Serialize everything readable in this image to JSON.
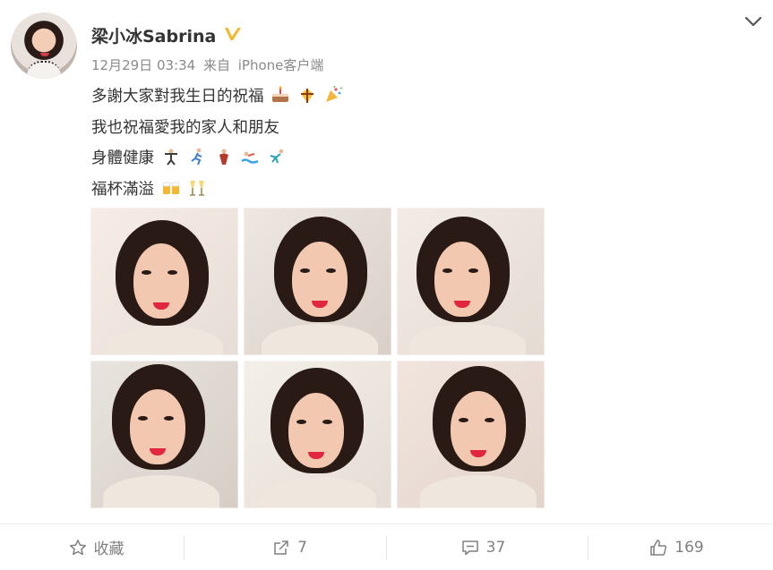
{
  "post": {
    "username": "梁小冰Sabrina",
    "date": "12月29日 03:34",
    "source_prefix": "来自",
    "source": "iPhone客户端",
    "text_lines": [
      "多謝大家對我生日的祝福",
      "我也祝福愛我的家人和朋友",
      "身體健康",
      "福杯滿溢"
    ]
  },
  "icons": {
    "verified_badge": "v-badge-icon",
    "menu": "chevron-down-icon",
    "favorite": "star-icon",
    "repost": "share-arrow-icon",
    "comment": "comment-icon",
    "like": "thumbs-up-icon"
  },
  "colors": {
    "badge": "#f6b92b",
    "text": "#333333",
    "meta": "#8a8a8a",
    "action": "#808080"
  },
  "actions": {
    "favorite_label": "收藏",
    "repost_count": "7",
    "comment_count": "37",
    "like_count": "169"
  }
}
